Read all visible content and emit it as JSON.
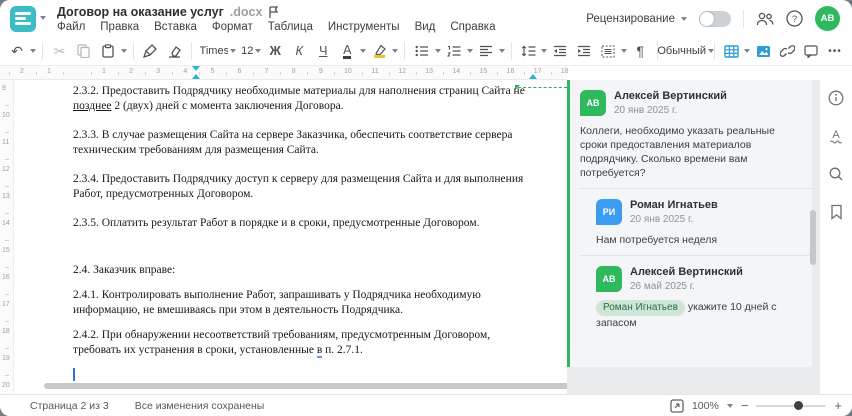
{
  "colors": {
    "logo_teal": "#3bbcc6",
    "accent_blue": "#2e9bd6",
    "comment_green": "#31b45c",
    "avatar_green": "#2eb95e",
    "avatar_blue": "#3b9cf2"
  },
  "header": {
    "doc_title": "Договор на оказание услуг",
    "doc_ext": ".docx",
    "menu": [
      "Файл",
      "Правка",
      "Вставка",
      "Формат",
      "Таблица",
      "Инструменты",
      "Вид",
      "Справка"
    ],
    "review_label": "Рецензирование",
    "review_toggle_on": false,
    "avatar_initials": "АВ"
  },
  "toolbar": {
    "font_name": "Times New ...",
    "font_size": "12",
    "bold_label": "Ж",
    "italic_label": "К",
    "underline_label": "Ч",
    "font_color_label": "А",
    "paragraph_mark": "¶",
    "style_name": "Обычный",
    "more_label": "•••"
  },
  "ruler": {
    "h_left_numbers": [
      "2",
      "1"
    ],
    "h_numbers": [
      "1",
      "2",
      "3",
      "4",
      "5",
      "6",
      "7",
      "8",
      "9",
      "10",
      "11",
      "12",
      "13",
      "14",
      "15",
      "16",
      "17",
      "18"
    ],
    "v_numbers": [
      "9",
      "10",
      "11",
      "12",
      "13",
      "14",
      "15",
      "16",
      "17",
      "18",
      "19",
      "20"
    ]
  },
  "document": {
    "paragraphs": [
      {
        "pre": "2.3.2. Предоставить Подрядчику необходимые материалы для наполнения страниц Сайта не ",
        "u": "позднее",
        "post": " 2 (двух) дней с момента заключения Договора."
      },
      {
        "text": "2.3.3. В случае размещения Сайта на сервере Заказчика, обеспечить соответствие сервера техническим требованиям для размещения Сайта."
      },
      {
        "text": "2.3.4. Предоставить Подрядчику доступ к серверу для размещения Сайта и для выполнения Работ, предусмотренных Договором."
      },
      {
        "text": "2.3.5. Оплатить результат Работ в порядке и в сроки, предусмотренные Договором."
      },
      {
        "text": "2.4. Заказчик вправе:"
      },
      {
        "text": "2.4.1. Контролировать выполнение Работ, запрашивать у Подрядчика необходимую информацию, не вмешиваясь при этом в деятельность Подрядчика."
      },
      {
        "pre": "2.4.2. При обнаружении несоответствий требованиям, предусмотренным Договором, требовать их устранения в сроки, установленные ",
        "u": "в",
        "post": " п. 2.7.1."
      }
    ]
  },
  "comments": {
    "items": [
      {
        "initials": "АВ",
        "name": "Алексей Вертинский",
        "date": "20 янв 2025 г.",
        "text": "Коллеги, необходимо указать реальные сроки предоставления материалов подрядчику. Сколько времени вам потребуется?",
        "color": "#2eb95e"
      },
      {
        "initials": "РИ",
        "name": "Роман Игнатьев",
        "date": "20 янв 2025 г.",
        "text": "Нам потребуется неделя",
        "color": "#3b9cf2"
      },
      {
        "initials": "АВ",
        "name": "Алексей Вертинский",
        "date": "26 май 2025 г.",
        "mention": "Роман Игнатьев",
        "text": "укажите 10 дней с запасом",
        "color": "#2eb95e"
      }
    ]
  },
  "statusbar": {
    "page_label": "Страница 2 из 3",
    "saved_label": "Все изменения сохранены",
    "zoom_value": "100%",
    "zoom_minus": "−",
    "zoom_plus": "+"
  }
}
